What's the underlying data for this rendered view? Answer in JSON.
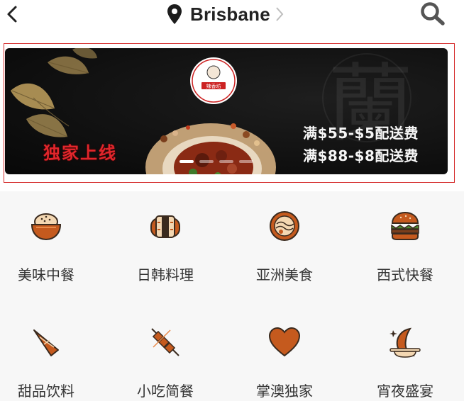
{
  "header": {
    "location": "Brisbane",
    "icons": [
      "back-arrow-icon",
      "location-pin-icon",
      "chevron-right-icon",
      "search-icon"
    ]
  },
  "banner": {
    "left_text": "独家上线",
    "promo_line_1": "满$55-$5配送费",
    "promo_line_2": "满$88-$8配送费",
    "watermark_char": "蘭",
    "slide_count": 4,
    "active_slide": 1,
    "frame_color": "#d52b2b",
    "accent_red": "#e0262c"
  },
  "categories": [
    {
      "label": "美味中餐",
      "icon": "rice-bowl-icon"
    },
    {
      "label": "日韩料理",
      "icon": "sushi-roll-icon"
    },
    {
      "label": "亚洲美食",
      "icon": "noodle-bowl-icon"
    },
    {
      "label": "西式快餐",
      "icon": "burger-icon"
    },
    {
      "label": "甜品饮料",
      "icon": "ice-cream-cone-icon"
    },
    {
      "label": "小吃简餐",
      "icon": "skewer-icon"
    },
    {
      "label": "掌澳独家",
      "icon": "heart-icon"
    },
    {
      "label": "宵夜盛宴",
      "icon": "moon-icon"
    }
  ],
  "colors": {
    "icon_brown": "#c55a1e",
    "icon_dark": "#3a2a1e",
    "icon_cream": "#f3d7b2"
  }
}
